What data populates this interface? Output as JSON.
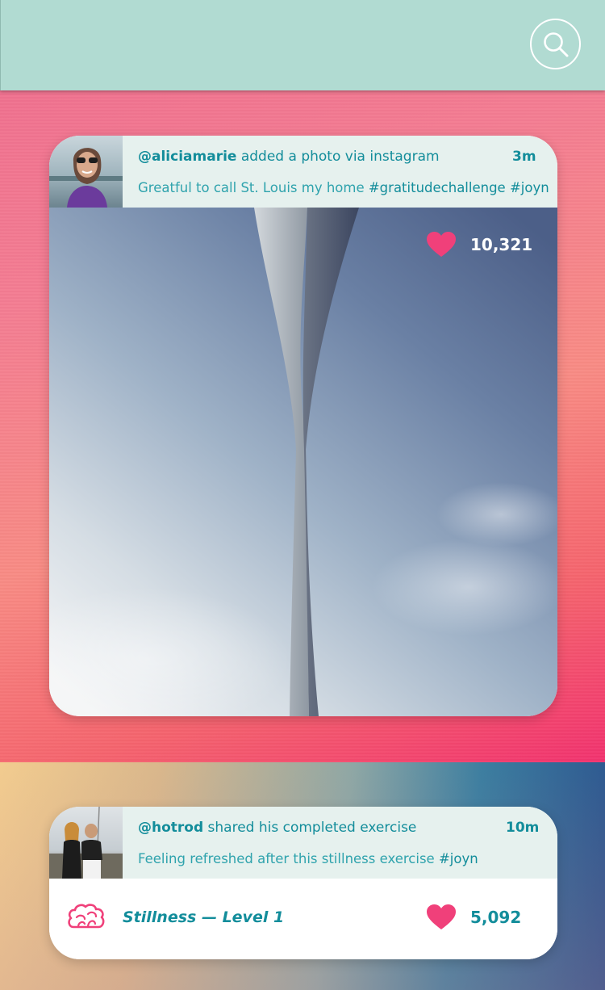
{
  "colors": {
    "topbar": "#b1dbd2",
    "accent_teal": "#138d9b",
    "heart_pink": "#f0407a",
    "header_bg": "#e6f1ee"
  },
  "topbar": {
    "search_icon": "search-icon"
  },
  "posts": [
    {
      "username": "@aliciamarie",
      "action": " added a photo via instagram",
      "time": "3m",
      "caption_text": "Greatful to call St. Louis my home ",
      "caption_tags": "#gratitudechallenge #joyn",
      "likes": "10,321",
      "photo_subject": "Gateway Arch against sky"
    },
    {
      "username": "@hotrod",
      "action": " shared his completed exercise",
      "time": "10m",
      "caption_text": "Feeling refreshed after this stillness exercise ",
      "caption_tags": "#joyn",
      "exercise": "Stillness — Level 1",
      "exercise_icon": "brain-icon",
      "likes": "5,092"
    }
  ]
}
